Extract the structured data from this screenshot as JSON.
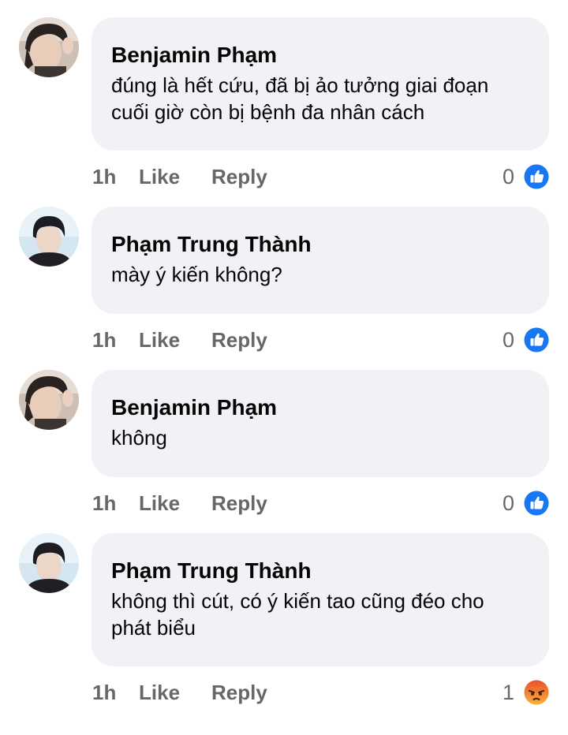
{
  "comments": [
    {
      "author": "Benjamin Phạm",
      "text": "đúng là hết cứu, đã bị ảo tưởng giai đoạn\ncuối giờ còn bị bệnh đa nhân cách",
      "time": "1h",
      "like_label": "Like",
      "reply_label": "Reply",
      "reaction_count": "0",
      "reaction_icon": "like-icon",
      "avatar": "avatar-benjamin"
    },
    {
      "author": "Phạm Trung Thành",
      "text": "mày ý kiến không?",
      "time": "1h",
      "like_label": "Like",
      "reply_label": "Reply",
      "reaction_count": "0",
      "reaction_icon": "like-icon",
      "avatar": "avatar-thanh"
    },
    {
      "author": "Benjamin Phạm",
      "text": "không",
      "time": "1h",
      "like_label": "Like",
      "reply_label": "Reply",
      "reaction_count": "0",
      "reaction_icon": "like-icon",
      "avatar": "avatar-benjamin"
    },
    {
      "author": "Phạm Trung Thành",
      "text": "không thì cút, có ý kiến tao cũng đéo cho\nphát biểu",
      "time": "1h",
      "like_label": "Like",
      "reply_label": "Reply",
      "reaction_count": "1",
      "reaction_icon": "angry-icon",
      "avatar": "avatar-thanh"
    }
  ],
  "colors": {
    "bubble": "#f0f2f5",
    "secondary_text": "#65676b",
    "like_blue": "#1877f2",
    "angry_orange": "#f26a22"
  }
}
